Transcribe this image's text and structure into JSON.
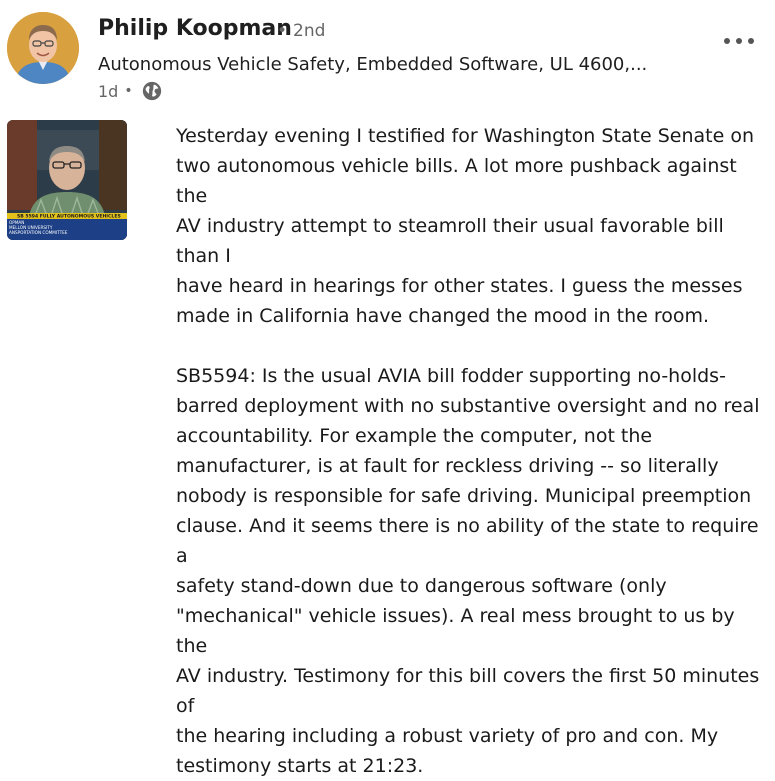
{
  "post": {
    "author": {
      "name": "Philip Koopman",
      "connection_degree": "2nd",
      "headline": "Autonomous Vehicle Safety, Embedded Software, UL 4600,...",
      "timestamp": "1d",
      "visibility_icon": "globe-icon"
    },
    "more_icon": "more-options-icon",
    "thumbnail": {
      "lines": [
        "SB 5594 FULLY AUTONOMOUS VEHICLES",
        "OPMAN",
        "MELLON UNIVERSITY",
        "ANSPORTATION COMMITTEE"
      ]
    },
    "paragraph1": "Yesterday evening I testified for Washington State Senate on\ntwo autonomous vehicle bills. A lot more pushback against the\nAV industry attempt to steamroll their usual favorable bill than I\nhave heard in hearings for other states. I guess the messes\nmade in California have changed the mood in the room.",
    "paragraph2": " SB5594: Is the usual AVIA bill fodder supporting no-holds-\nbarred deployment with no substantive oversight and no real\naccountability. For example the computer, not the\nmanufacturer, is at fault for reckless driving -- so literally\nnobody is responsible for safe driving. Municipal preemption\nclause. And it seems there is no ability of the state to require a\nsafety stand-down due to dangerous software (only\n\"mechanical\" vehicle issues). A real mess brought to us by the\nAV industry. Testimony for this bill covers the first 50 minutes of\nthe hearing including a robust variety of pro and con. My\ntestimony starts at 21:23."
  },
  "colors": {
    "text": "#1a1a1a",
    "secondary": "#666666",
    "avatar_bg": "#d9a040"
  }
}
